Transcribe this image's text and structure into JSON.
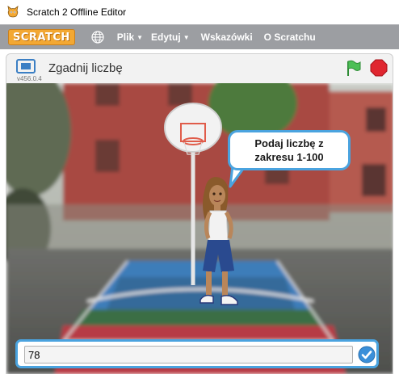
{
  "window": {
    "title": "Scratch 2 Offline Editor"
  },
  "menubar": {
    "logo": "SCRATCH",
    "items": [
      {
        "label": "Plik",
        "has_caret": true
      },
      {
        "label": "Edytuj",
        "has_caret": true
      },
      {
        "label": "Wskazówki",
        "has_caret": false
      },
      {
        "label": "O Scratchu",
        "has_caret": false
      }
    ]
  },
  "stage_header": {
    "version": "v456.0.4",
    "project_title": "Zgadnij liczbę"
  },
  "speech_bubble": {
    "line1": "Podaj liczbę z",
    "line2": "zakresu 1-100"
  },
  "ask": {
    "value": "78"
  },
  "colors": {
    "accent": "#4aa3df",
    "menubar": "#9c9ea2",
    "logo": "#f3a833",
    "flag": "#4cbf56",
    "stop": "#e0262f"
  },
  "icons": {
    "app": "scratch-cat-icon",
    "globe": "globe-icon",
    "fullscreen": "fullscreen-icon",
    "flag": "green-flag-icon",
    "stop": "stop-sign-icon",
    "check": "checkmark-icon"
  }
}
